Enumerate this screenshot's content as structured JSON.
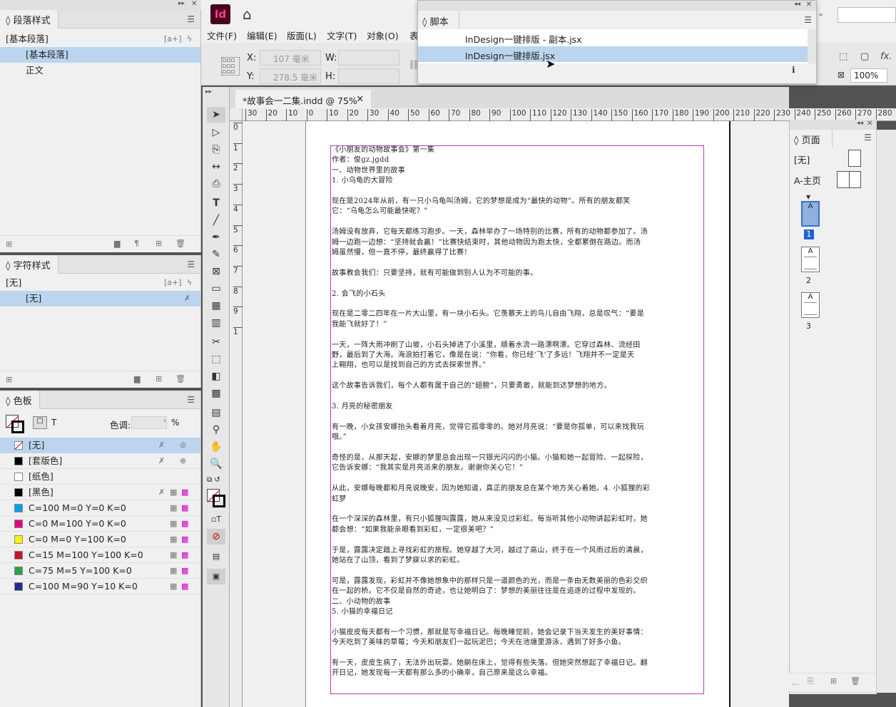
{
  "app": {
    "logo": "Id",
    "home": "⌂"
  },
  "menu": [
    "文件(F)",
    "编辑(E)",
    "版面(L)",
    "文字(T)",
    "对象(O)",
    "表"
  ],
  "control": {
    "x_label": "X:",
    "x_value": "107 毫米",
    "y_label": "Y:",
    "y_value": "278.5 毫米",
    "w_label": "W:",
    "h_label": "H:",
    "zoom": "100%"
  },
  "script_panel": {
    "title": "脚本",
    "items": [
      "InDesign一键排版 - 副本.jsx",
      "InDesign一键排版.jsx"
    ]
  },
  "para_styles": {
    "title": "段落样式",
    "header": "[基本段落]",
    "plus": "[a+]",
    "items": [
      "[基本段落]",
      "正文"
    ]
  },
  "char_styles": {
    "title": "字符样式",
    "header": "[无]",
    "plus": "[a+]",
    "items": [
      "[无]"
    ]
  },
  "swatches": {
    "title": "色板",
    "tint_label": "色调:",
    "percent": "%",
    "t_label": "T",
    "items": [
      "[无]",
      "[套版色]",
      "[纸色]",
      "[黑色]",
      "C=100 M=0 Y=0 K=0",
      "C=0 M=100 Y=0 K=0",
      "C=0 M=0 Y=100 K=0",
      "C=15 M=100 Y=100 K=0",
      "C=75 M=5 Y=100 K=0",
      "C=100 M=90 Y=10 K=0"
    ],
    "colors": [
      "#ffffff",
      "#000000",
      "#ffffff",
      "#000000",
      "#00a0e9",
      "#e4007f",
      "#fff100",
      "#c8161e",
      "#2ea043",
      "#1d2f8c"
    ]
  },
  "doc_tab": "*故事会一二集.indd @ 75%",
  "ruler_h": [
    "30",
    "20",
    "10",
    "0",
    "10",
    "20",
    "30",
    "40",
    "50",
    "60",
    "70",
    "80",
    "90",
    "100",
    "110",
    "120",
    "130",
    "140",
    "150",
    "160",
    "170",
    "180",
    "190",
    "200",
    "210",
    "220",
    "230",
    "240",
    "250",
    "260",
    "270",
    "280"
  ],
  "ruler_v": [
    "0",
    "1",
    "2",
    "3",
    "4",
    "5",
    "6",
    "7",
    "8",
    "9",
    "1"
  ],
  "pages_panel": {
    "title": "页面",
    "none": "[无]",
    "master": "A-主页",
    "pages": [
      "1",
      "2",
      "3"
    ],
    "more": "..."
  },
  "doc_lines": [
    "《小朋友的动物故事会》第一集",
    "作者：俊gz.jgdd",
    "一、动物世界里的故事",
    "1. 小乌龟的大冒险",
    "",
    "现在是2024年从前，有一只小乌龟叫汤姆，它的梦想是成为“最快的动物”。所有的朋友都笑",
    "它：“乌龟怎么可能最快呢？”",
    "",
    "汤姆没有放弃，它每天都练习跑步。一天，森林举办了一场特别的比赛，所有的动物都参加了。汤",
    "姆一边跑一边想：“坚持就会赢！”比赛快结束时，其他动物因为跑太快，全都累倒在路边。而汤",
    "姆虽然慢，但一直不停，最终赢得了比赛！",
    "",
    "故事教会我们：只要坚持，就有可能做到别人认为不可能的事。",
    "",
    "2. 会飞的小石头",
    "",
    "现在是二零二四年在一片大山里，有一块小石头。它羡慕天上的鸟儿自由飞翔，总是叹气：“要是",
    "我能飞就好了！”",
    "",
    "一天，一阵大雨冲刷了山坡，小石头掉进了小溪里，顺着水流一路漂啊漂。它穿过森林、流经田",
    "野，最后到了大海。海浪拍打着它，像是在说：“你看，你已经‘飞’了多远！飞翔并不一定是天",
    "上翱翔，也可以是找到自己的方式去探索世界。”",
    "",
    "这个故事告诉我们，每个人都有属于自己的“翅膀”，只要勇敢，就能到达梦想的地方。",
    "",
    "3. 月亮的秘密朋友",
    "",
    "有一晚，小女孩安娜抬头看着月亮，觉得它孤零零的。她对月亮说：“要是你孤单，可以来找我玩",
    "哦。”",
    "",
    "奇怪的是，从那天起，安娜的梦里总会出现一只银光闪闪的小猫。小猫和她一起冒险、一起探险，",
    "它告诉安娜：“我其实是月亮派来的朋友。谢谢你关心它！”",
    "",
    "从此，安娜每晚都和月亮说晚安，因为她知道，真正的朋友总在某个地方关心着她。4. 小狐狸的彩",
    "虹梦",
    "",
    "在一个深深的森林里，有只小狐狸叫露露，她从来没见过彩虹。每当听其他小动物讲起彩虹时，她",
    "都会想：“如果我能亲眼看到彩虹，一定很美吧？”",
    "",
    "于是，露露决定踏上寻找彩虹的旅程。她穿越了大河，越过了高山，终于在一个风雨过后的清晨，",
    "她站在了山顶，看到了梦寐以求的彩虹。",
    "",
    "可是，露露发现，彩虹并不像她想象中的那样只是一道颜色的光，而是一条由无数美丽的色彩交织",
    "在一起的桥。它不仅是自然的奇迹，也让她明白了：梦想的美丽往往是在追逐的过程中发现的。",
    "二、小动物的故事",
    "5. 小猫的幸福日记",
    "",
    "小猫皮皮每天都有一个习惯，那就是写幸福日记。每晚睡觉前，她会记录下当天发生的美好事情：",
    "今天吃到了美味的草莓；今天和朋友们一起玩泥巴；今天在池塘里游泳，遇到了好多小鱼。",
    "",
    "有一天，皮皮生病了，无法外出玩耍。她躺在床上，觉得有些失落。但她突然想起了幸福日记。翻",
    "开日记，她发现每一天都有那么多的小确幸，自己原来是这么幸福。"
  ]
}
